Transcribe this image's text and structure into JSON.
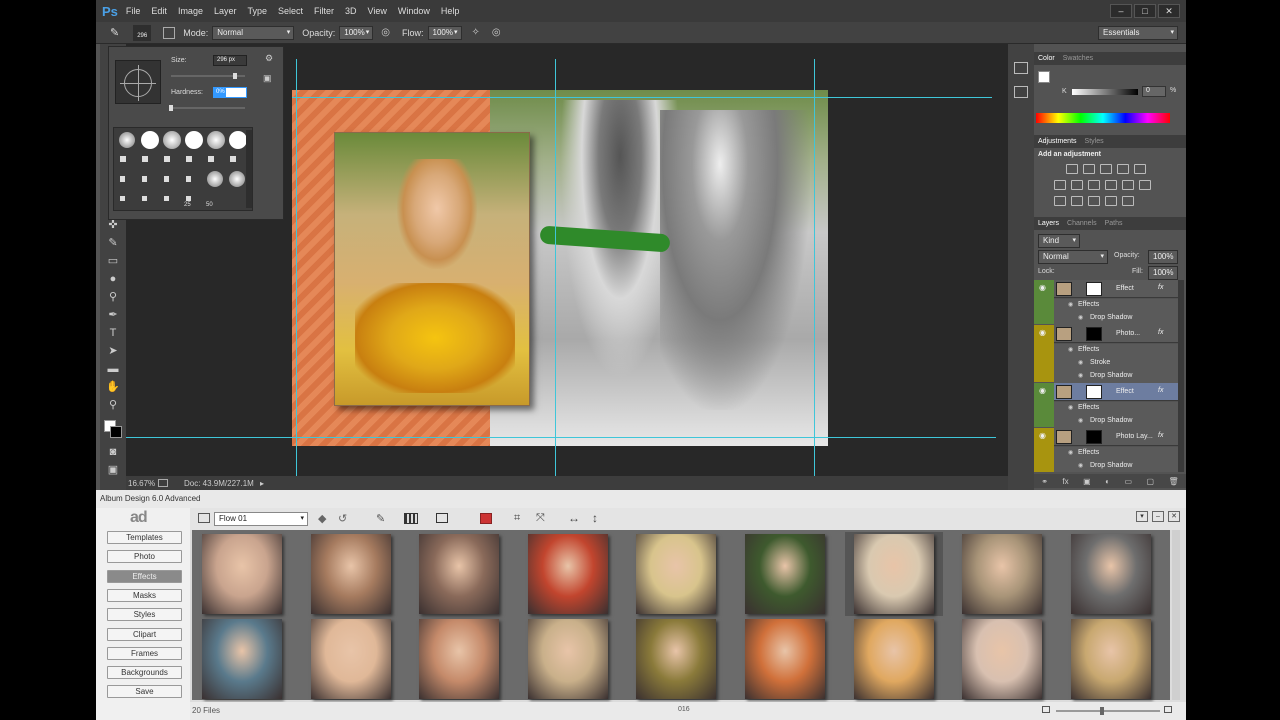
{
  "app": {
    "logo": "Ps",
    "menu": [
      "File",
      "Edit",
      "Image",
      "Layer",
      "Type",
      "Select",
      "Filter",
      "3D",
      "View",
      "Window",
      "Help"
    ],
    "window_buttons": [
      "–",
      "□",
      "✕"
    ]
  },
  "options_bar": {
    "brush_size": "296",
    "mode_label": "Mode:",
    "mode_value": "Normal",
    "opacity_label": "Opacity:",
    "opacity_value": "100%",
    "flow_label": "Flow:",
    "flow_value": "100%",
    "workspace": "Essentials"
  },
  "brush_panel": {
    "size_label": "Size:",
    "size_value": "296 px",
    "hardness_label": "Hardness:",
    "hardness_value": "0%",
    "preset_labels": [
      "25",
      "50"
    ]
  },
  "status": {
    "zoom": "16.67%",
    "doc": "Doc: 43.9M/227.1M"
  },
  "color_panel": {
    "tabs": [
      "Color",
      "Swatches"
    ],
    "k_label": "K",
    "k_value": "0",
    "k_unit": "%"
  },
  "adjustments_panel": {
    "tabs": [
      "Adjustments",
      "Styles"
    ],
    "heading": "Add an adjustment"
  },
  "layers_panel": {
    "tabs": [
      "Layers",
      "Channels",
      "Paths"
    ],
    "kind": "Kind",
    "blend_mode": "Normal",
    "opacity_label": "Opacity:",
    "opacity_value": "100%",
    "lock_label": "Lock:",
    "fill_label": "Fill:",
    "fill_value": "100%",
    "layers": [
      {
        "name": "Effect",
        "color": "#5a8a3a",
        "selected": false,
        "effects": [
          "Effects",
          "Drop Shadow"
        ]
      },
      {
        "name": "Photo...",
        "color": "#a8940f",
        "selected": false,
        "effects": [
          "Effects",
          "Stroke",
          "Drop Shadow"
        ]
      },
      {
        "name": "Effect",
        "color": "#5a8a3a",
        "selected": true,
        "effects": [
          "Effects",
          "Drop Shadow"
        ]
      },
      {
        "name": "Photo Lay...",
        "color": "#a8940f",
        "selected": false,
        "effects": [
          "Effects",
          "Drop Shadow"
        ]
      }
    ]
  },
  "album": {
    "title": "Album Design 6.0 Advanced",
    "logo": "ad",
    "flow_select": "Flow 01",
    "buttons": [
      "Templates",
      "Photo",
      "Effects",
      "Masks",
      "Styles",
      "Clipart",
      "Frames",
      "Backgrounds",
      "Save"
    ],
    "active_button": "Effects",
    "status_left": "20 Files",
    "status_mid": "016",
    "thumb_colors_row1": [
      "#c9a48e",
      "#a67b5f",
      "#8a6a5a",
      "#c2452e",
      "#d8c48c",
      "#3e5a2e",
      "#d9c9b0",
      "#a89478",
      "#6e6e6e"
    ],
    "thumb_colors_row2": [
      "#5a7a8c",
      "#e0b898",
      "#c58a6a",
      "#c9b08a",
      "#8a7a3a",
      "#d0703a",
      "#e0a860",
      "#d8c0b0",
      "#c8a870"
    ]
  }
}
